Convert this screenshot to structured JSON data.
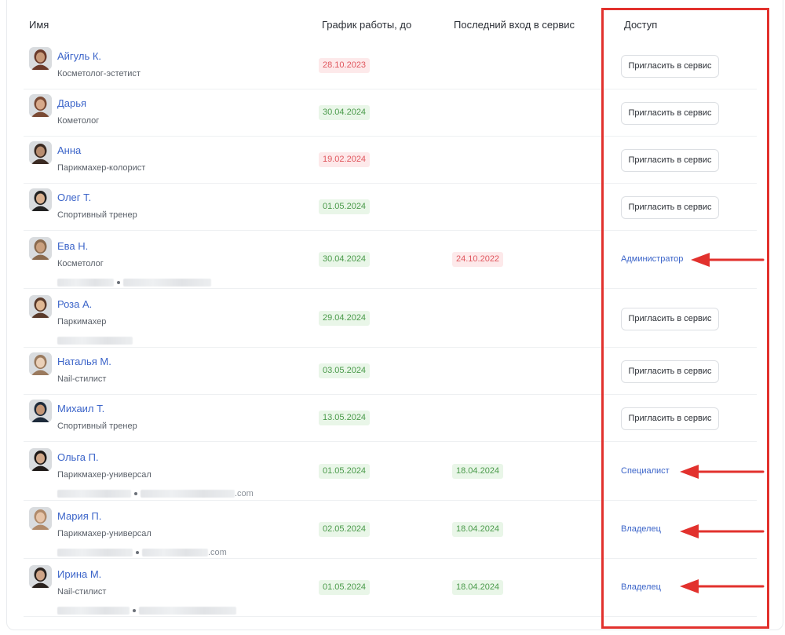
{
  "table": {
    "headers": {
      "name": "Имя",
      "schedule": "График работы, до",
      "last_login": "Последний вход в сервис",
      "access": "Доступ"
    },
    "invite_label": "Пригласить в сервис",
    "rows": [
      {
        "name": "Айгуль К.",
        "role": "Косметолог-эстетист",
        "schedule": "28.10.2023",
        "schedule_status": "expired",
        "last_login": "",
        "access": "invite"
      },
      {
        "name": "Дарья",
        "role": "Кометолог",
        "schedule": "30.04.2024",
        "schedule_status": "active",
        "last_login": "",
        "access": "invite"
      },
      {
        "name": "Анна",
        "role": "Парикмахер-колорист",
        "schedule": "19.02.2024",
        "schedule_status": "expired",
        "last_login": "",
        "access": "invite"
      },
      {
        "name": "Олег Т.",
        "role": "Спортивный тренер",
        "schedule": "01.05.2024",
        "schedule_status": "active",
        "last_login": "",
        "access": "invite"
      },
      {
        "name": "Ева Н.",
        "role": "Косметолог",
        "contact_suffix": "",
        "schedule": "30.04.2024",
        "schedule_status": "active",
        "last_login": "24.10.2022",
        "last_login_status": "expired",
        "access": "Администратор"
      },
      {
        "name": "Роза А.",
        "role": "Паркимахер",
        "schedule": "29.04.2024",
        "schedule_status": "active",
        "last_login": "",
        "access": "invite"
      },
      {
        "name": "Наталья М.",
        "role": "Nail-стилист",
        "schedule": "03.05.2024",
        "schedule_status": "active",
        "last_login": "",
        "access": "invite"
      },
      {
        "name": "Михаил Т.",
        "role": "Спортивный тренер",
        "schedule": "13.05.2024",
        "schedule_status": "active",
        "last_login": "",
        "access": "invite"
      },
      {
        "name": "Ольга П.",
        "role": "Парикмахер-универсал",
        "contact_suffix": ".com",
        "schedule": "01.05.2024",
        "schedule_status": "active",
        "last_login": "18.04.2024",
        "last_login_status": "active",
        "access": "Специалист"
      },
      {
        "name": "Мария П.",
        "role": "Парикмахер-универсал",
        "contact_suffix": ".com",
        "schedule": "02.05.2024",
        "schedule_status": "active",
        "last_login": "18.04.2024",
        "last_login_status": "active",
        "access": "Владелец"
      },
      {
        "name": "Ирина М.",
        "role": "Nail-стилист",
        "contact_suffix": "",
        "schedule": "01.05.2024",
        "schedule_status": "active",
        "last_login": "18.04.2024",
        "last_login_status": "active",
        "access": "Владелец"
      }
    ]
  },
  "colors": {
    "link": "#3b64c9",
    "highlight": "#e2312d",
    "badge_green_bg": "#e9f6e8",
    "badge_green_text": "#4a9a4a",
    "badge_red_bg": "#fde9ea",
    "badge_red_text": "#e0575e"
  }
}
